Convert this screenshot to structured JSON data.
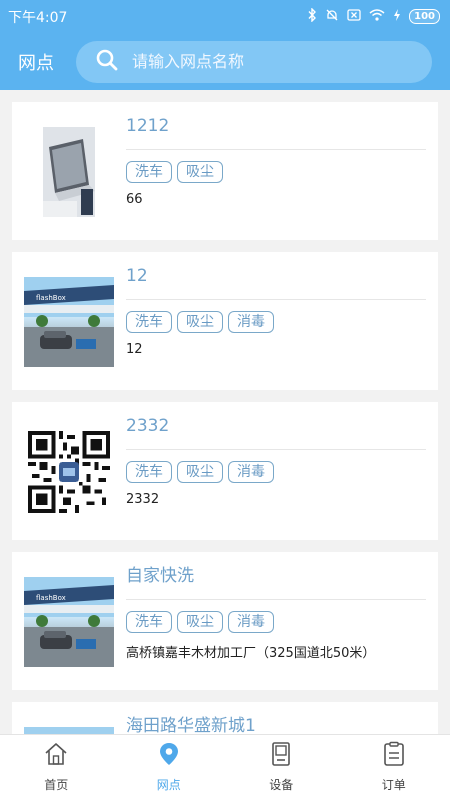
{
  "status_bar": {
    "time": "下午4:07",
    "battery": "100"
  },
  "header": {
    "title": "网点",
    "search_placeholder": "请输入网点名称"
  },
  "outlets": [
    {
      "name": "1212",
      "tags": [
        "洗车",
        "吸尘"
      ],
      "desc": "66",
      "thumb": "laptop-photo"
    },
    {
      "name": "12",
      "tags": [
        "洗车",
        "吸尘",
        "消毒"
      ],
      "desc": "12",
      "thumb": "car-wash-photo"
    },
    {
      "name": "2332",
      "tags": [
        "洗车",
        "吸尘",
        "消毒"
      ],
      "desc": "2332",
      "thumb": "qr-code"
    },
    {
      "name": "自家快洗",
      "tags": [
        "洗车",
        "吸尘",
        "消毒"
      ],
      "desc": "高桥镇嘉丰木材加工厂（325国道北50米）",
      "thumb": "car-wash-photo"
    },
    {
      "name": "海田路华盛新城1",
      "tags": [],
      "desc": "",
      "thumb": "car-wash-photo"
    }
  ],
  "photo_sign": "flashBox",
  "tabs": [
    {
      "label": "首页",
      "icon": "home-icon",
      "active": false
    },
    {
      "label": "网点",
      "icon": "location-pin-icon",
      "active": true
    },
    {
      "label": "设备",
      "icon": "device-icon",
      "active": false
    },
    {
      "label": "订单",
      "icon": "order-icon",
      "active": false
    }
  ],
  "colors": {
    "primary": "#5bb3f0",
    "active_tab": "#4fa8ea",
    "name_text": "#6fa1cb",
    "tag_border": "#7aa8c9"
  }
}
